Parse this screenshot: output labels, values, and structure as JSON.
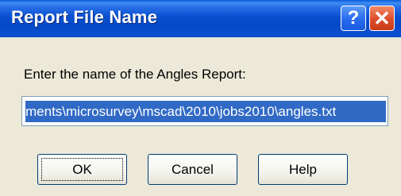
{
  "window": {
    "title": "Report File Name",
    "help_glyph": "?",
    "close_glyph": "✕"
  },
  "dialog": {
    "prompt": "Enter the name of the Angles Report:",
    "path_value": "ments\\microsurvey\\mscad\\2010\\jobs2010\\angles.txt"
  },
  "buttons": {
    "ok": "OK",
    "cancel": "Cancel",
    "help": "Help"
  },
  "colors": {
    "titlebar": "#0b50cf",
    "selection": "#316ac5",
    "face": "#ece9d8",
    "close": "#d9542f"
  }
}
